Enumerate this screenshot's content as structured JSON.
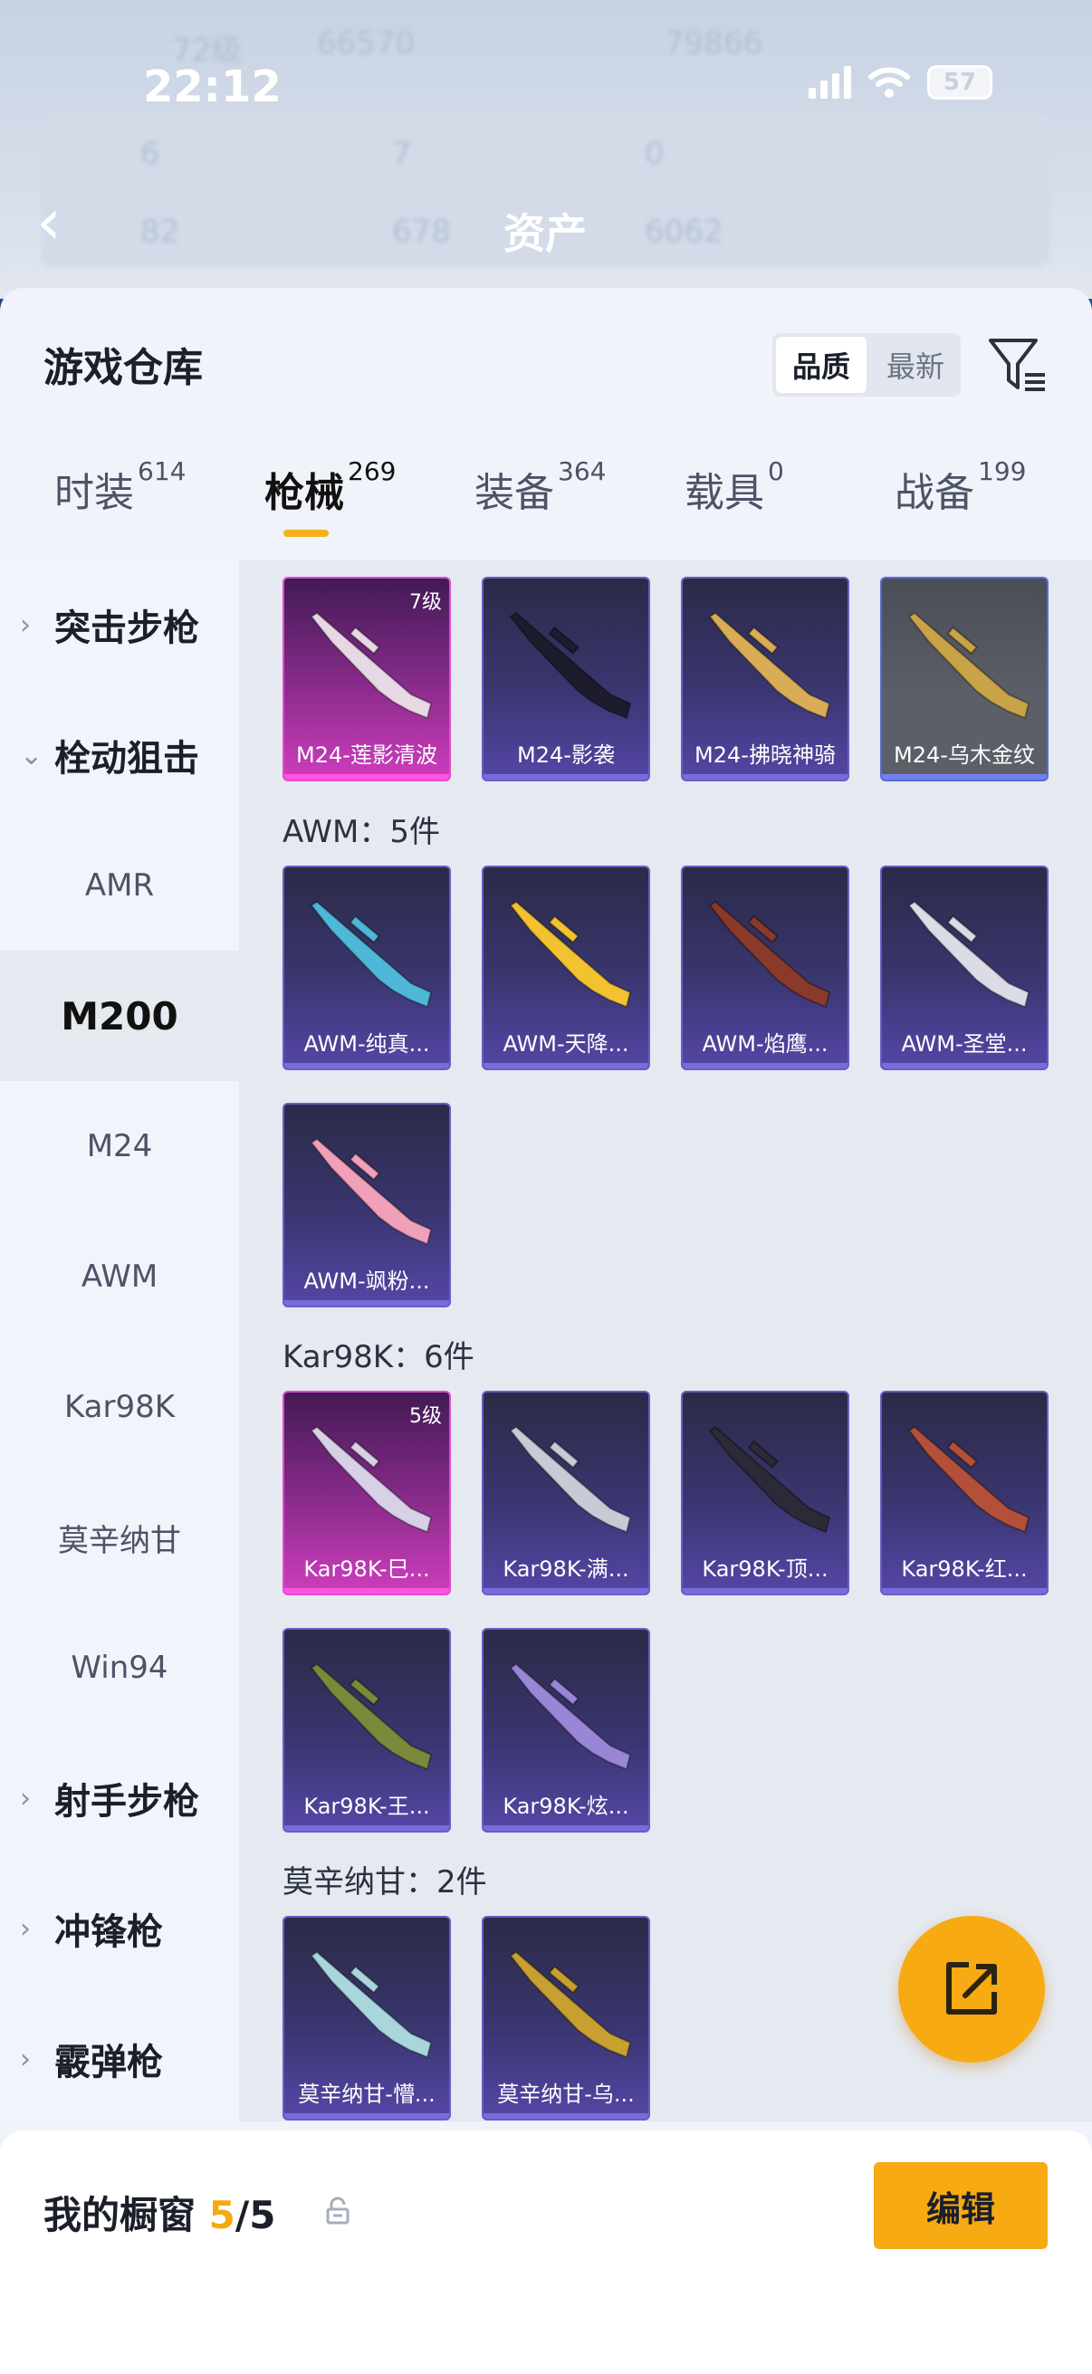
{
  "status": {
    "time": "22:12",
    "battery": "57"
  },
  "header": {
    "title": "资产"
  },
  "background_blur": {
    "level": "72级",
    "coins": "66570",
    "points": "79866",
    "row1": [
      "6",
      "7",
      "0"
    ],
    "row2": [
      "82",
      "678",
      "6062"
    ]
  },
  "panel": {
    "title": "游戏仓库",
    "sort": {
      "quality": "品质",
      "newest": "最新"
    }
  },
  "tabs": [
    {
      "label": "时装",
      "count": "614"
    },
    {
      "label": "枪械",
      "count": "269"
    },
    {
      "label": "装备",
      "count": "364"
    },
    {
      "label": "载具",
      "count": "0"
    },
    {
      "label": "战备",
      "count": "199"
    }
  ],
  "sidebar": {
    "items": [
      {
        "label": "突击步枪",
        "type": "group",
        "expanded": false
      },
      {
        "label": "栓动狙击",
        "type": "group",
        "expanded": true
      },
      {
        "label": "AMR",
        "type": "sub"
      },
      {
        "label": "M200",
        "type": "sub",
        "selected": true
      },
      {
        "label": "M24",
        "type": "sub"
      },
      {
        "label": "AWM",
        "type": "sub"
      },
      {
        "label": "Kar98K",
        "type": "sub"
      },
      {
        "label": "莫辛纳甘",
        "type": "sub"
      },
      {
        "label": "Win94",
        "type": "sub"
      },
      {
        "label": "射手步枪",
        "type": "group",
        "expanded": false
      },
      {
        "label": "冲锋枪",
        "type": "group",
        "expanded": false
      },
      {
        "label": "霰弹枪",
        "type": "group",
        "expanded": false
      }
    ]
  },
  "groups": {
    "m24": {
      "items": [
        {
          "name": "M24-莲影清波",
          "level": "7级",
          "rarity": "pink",
          "gun_color": "#e8d8e6"
        },
        {
          "name": "M24-影袭",
          "rarity": "purple",
          "gun_color": "#1c1c2c"
        },
        {
          "name": "M24-拂晓神骑",
          "rarity": "purple",
          "gun_color": "#d9ad55"
        },
        {
          "name": "M24-乌木金纹",
          "rarity": "grey",
          "gun_color": "#c9a347"
        }
      ]
    },
    "awm": {
      "label": "AWM：5件",
      "items": [
        {
          "name": "AWM-纯真...",
          "rarity": "purple",
          "gun_color": "#4fb7d8"
        },
        {
          "name": "AWM-天降...",
          "rarity": "purple",
          "gun_color": "#f2c230"
        },
        {
          "name": "AWM-焰鹰...",
          "rarity": "purple",
          "gun_color": "#8a3a2a"
        },
        {
          "name": "AWM-圣堂...",
          "rarity": "purple",
          "gun_color": "#dcdce6"
        },
        {
          "name": "AWM-飒粉...",
          "rarity": "purple",
          "gun_color": "#f0a0b8"
        }
      ]
    },
    "kar98k": {
      "label": "Kar98K：6件",
      "items": [
        {
          "name": "Kar98K-巳...",
          "level": "5级",
          "rarity": "pink",
          "gun_color": "#d8d0e6"
        },
        {
          "name": "Kar98K-满...",
          "rarity": "purple",
          "gun_color": "#c8cad6"
        },
        {
          "name": "Kar98K-顶...",
          "rarity": "purple",
          "gun_color": "#2c2a36"
        },
        {
          "name": "Kar98K-红...",
          "rarity": "purple",
          "gun_color": "#b4503a"
        },
        {
          "name": "Kar98K-王...",
          "rarity": "purple",
          "gun_color": "#7a8a3a"
        },
        {
          "name": "Kar98K-炫...",
          "rarity": "purple",
          "gun_color": "#9a86d6"
        }
      ]
    },
    "mosin": {
      "label": "莫辛纳甘：2件",
      "items": [
        {
          "name": "莫辛纳甘-懵...",
          "rarity": "purple",
          "gun_color": "#a8d6dc"
        },
        {
          "name": "莫辛纳甘-乌...",
          "rarity": "purple",
          "gun_color": "#c8a030"
        }
      ]
    }
  },
  "bottom": {
    "showcase_label": "我的橱窗",
    "showcase_current": "5",
    "showcase_total": "/5",
    "edit_label": "编辑"
  },
  "colors": {
    "accent": "#f7aa12",
    "pink_rarity": "#e24ad0",
    "purple_rarity": "#6a5cc7"
  }
}
